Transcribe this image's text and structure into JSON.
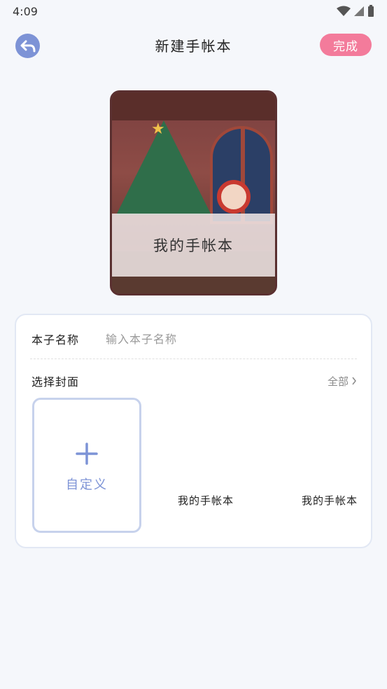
{
  "status": {
    "time": "4:09"
  },
  "header": {
    "title": "新建手帐本",
    "done_label": "完成"
  },
  "preview": {
    "cover_title": "我的手帐本"
  },
  "form": {
    "name_label": "本子名称",
    "name_placeholder": "输入本子名称",
    "name_value": "",
    "cover_label": "选择封面",
    "all_label": "全部",
    "custom_label": "自定义",
    "covers": [
      {
        "label": "我的手帐本"
      },
      {
        "label": "我的手帐本"
      }
    ]
  },
  "colors": {
    "accent": "#7d93d6",
    "done": "#f37b9b",
    "background": "#f5f7fb"
  }
}
